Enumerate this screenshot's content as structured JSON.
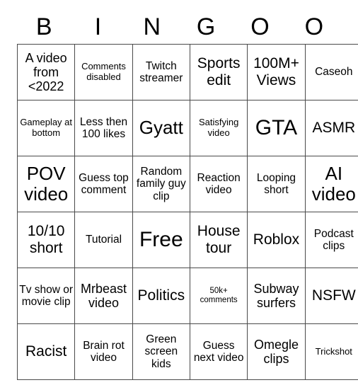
{
  "card": {
    "header_letters": [
      "B",
      "I",
      "N",
      "G",
      "O",
      "O"
    ],
    "columns": 6,
    "rows": 6,
    "border_color": "#4a4a4a",
    "background_color": "#ffffff",
    "text_color": "#000000",
    "cells": [
      [
        {
          "text": "A video from <2022",
          "size": "lg"
        },
        {
          "text": "Comments disabled",
          "size": "sm"
        },
        {
          "text": "Twitch streamer",
          "size": "md"
        },
        {
          "text": "Sports edit",
          "size": "xl"
        },
        {
          "text": "100M+ Views",
          "size": "xl"
        },
        {
          "text": "Caseoh",
          "size": "md"
        }
      ],
      [
        {
          "text": "Gameplay at bottom",
          "size": "sm"
        },
        {
          "text": "Less then 100 likes",
          "size": "md"
        },
        {
          "text": "Gyatt",
          "size": "xxl"
        },
        {
          "text": "Satisfying video",
          "size": "sm"
        },
        {
          "text": "GTA",
          "size": "huge"
        },
        {
          "text": "ASMR",
          "size": "xl"
        }
      ],
      [
        {
          "text": "POV video",
          "size": "xxl"
        },
        {
          "text": "Guess top comment",
          "size": "md"
        },
        {
          "text": "Random family guy clip",
          "size": "md"
        },
        {
          "text": "Reaction video",
          "size": "md"
        },
        {
          "text": "Looping short",
          "size": "md"
        },
        {
          "text": "AI video",
          "size": "xxl"
        }
      ],
      [
        {
          "text": "10/10 short",
          "size": "xl"
        },
        {
          "text": "Tutorial",
          "size": "md"
        },
        {
          "text": "Free",
          "size": "huge"
        },
        {
          "text": "House tour",
          "size": "xl"
        },
        {
          "text": "Roblox",
          "size": "xl"
        },
        {
          "text": "Podcast clips",
          "size": "md"
        }
      ],
      [
        {
          "text": "Tv show or movie clip",
          "size": "md"
        },
        {
          "text": "Mrbeast video",
          "size": "lg"
        },
        {
          "text": "Politics",
          "size": "xl"
        },
        {
          "text": "50k+ comments",
          "size": "xs"
        },
        {
          "text": "Subway surfers",
          "size": "lg"
        },
        {
          "text": "NSFW",
          "size": "xl"
        }
      ],
      [
        {
          "text": "Racist",
          "size": "xl"
        },
        {
          "text": "Brain rot video",
          "size": "md"
        },
        {
          "text": "Green screen kids",
          "size": "md"
        },
        {
          "text": "Guess next video",
          "size": "md"
        },
        {
          "text": "Omegle clips",
          "size": "lg"
        },
        {
          "text": "Trickshot",
          "size": "sm"
        }
      ]
    ]
  }
}
